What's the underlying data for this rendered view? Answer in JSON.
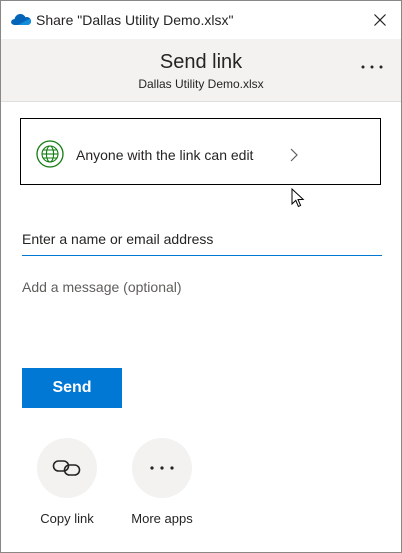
{
  "window": {
    "title": "Share \"Dallas Utility Demo.xlsx\"",
    "app_icon": "onedrive-cloud-icon",
    "close_icon": "close-icon"
  },
  "header": {
    "title": "Send link",
    "subtitle": "Dallas Utility Demo.xlsx",
    "more_icon": "more-options-icon"
  },
  "link_settings": {
    "label": "Anyone with the link can edit",
    "icon": "globe-icon",
    "chevron_icon": "chevron-right-icon"
  },
  "recipients": {
    "placeholder": "Enter a name or email address",
    "value": ""
  },
  "message": {
    "placeholder": "Add a message (optional)",
    "value": ""
  },
  "send_button": {
    "label": "Send"
  },
  "share_options": [
    {
      "label": "Copy link",
      "icon": "link-icon"
    },
    {
      "label": "More apps",
      "icon": "ellipsis-icon"
    }
  ],
  "colors": {
    "accent": "#0078d4",
    "header_bg": "#f3f2f1",
    "globe_green": "#107c10"
  }
}
